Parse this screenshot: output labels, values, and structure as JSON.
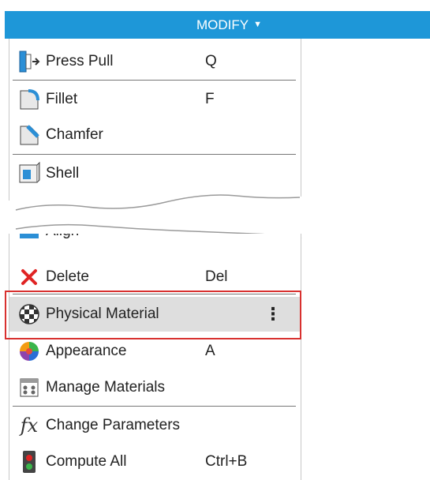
{
  "menu": {
    "title": "MODIFY"
  },
  "items_top": [
    {
      "label": "Press Pull",
      "shortcut": "Q",
      "icon": "press-pull-icon"
    },
    {
      "label": "Fillet",
      "shortcut": "F",
      "icon": "fillet-icon"
    },
    {
      "label": "Chamfer",
      "shortcut": "",
      "icon": "chamfer-icon"
    },
    {
      "label": "Shell",
      "shortcut": "",
      "icon": "shell-icon"
    }
  ],
  "items_bottom": [
    {
      "label": "Align",
      "shortcut": "",
      "icon": "align-icon"
    },
    {
      "label": "Delete",
      "shortcut": "Del",
      "icon": "delete-x-icon"
    },
    {
      "label": "Physical Material",
      "shortcut": "",
      "icon": "physical-material-icon",
      "selected": true
    },
    {
      "label": "Appearance",
      "shortcut": "A",
      "icon": "appearance-icon"
    },
    {
      "label": "Manage Materials",
      "shortcut": "",
      "icon": "manage-materials-icon"
    },
    {
      "label": "Change Parameters",
      "shortcut": "",
      "icon": "fx-icon"
    },
    {
      "label": "Compute All",
      "shortcut": "Ctrl+B",
      "icon": "compute-all-icon"
    }
  ],
  "colors": {
    "menu_bar": "#1e97d8",
    "highlight_border": "#d8312f",
    "selected_bg": "#dedede"
  }
}
